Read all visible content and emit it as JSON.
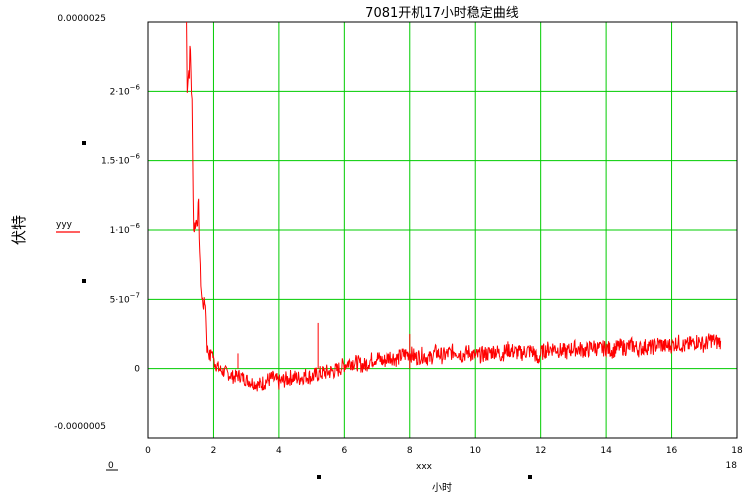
{
  "chart_data": {
    "type": "line",
    "title": "7081开机17小时稳定曲线",
    "xlabel": "小时",
    "ylabel": "伏特",
    "x_var_label": "xxx",
    "x_min_label": "0",
    "x_max_label": "18",
    "y_top_label": "0.0000025",
    "y_bottom_label": "-0.0000005",
    "xlim": [
      0,
      18
    ],
    "ylim": [
      -5e-07,
      2.5e-06
    ],
    "x_ticks": [
      "0",
      "2",
      "4",
      "6",
      "8",
      "10",
      "12",
      "14",
      "16",
      "18"
    ],
    "x_tick_values": [
      0,
      2,
      4,
      6,
      8,
      10,
      12,
      14,
      16,
      18
    ],
    "y_ticks": [
      {
        "value": 2e-06,
        "mantissa": "2",
        "exp": "−6"
      },
      {
        "value": 1.5e-06,
        "mantissa": "1.5",
        "exp": "−6"
      },
      {
        "value": 1e-06,
        "mantissa": "1",
        "exp": "−6"
      },
      {
        "value": 5e-07,
        "mantissa": "5",
        "exp": "−7"
      },
      {
        "value": 0,
        "mantissa": "0",
        "exp": ""
      }
    ],
    "grid": true,
    "grid_color": "#00cc00",
    "legend": {
      "name": "yyy",
      "placement": "left"
    },
    "series": [
      {
        "name": "yyy",
        "color": "#ff0000",
        "x": [
          1.18,
          1.2,
          1.25,
          1.3,
          1.35,
          1.4,
          1.45,
          1.5,
          1.55,
          1.6,
          1.65,
          1.7,
          1.75,
          1.8,
          1.85,
          1.9,
          1.95,
          2.0,
          2.1,
          2.2,
          2.4,
          2.6,
          2.8,
          3.0,
          3.2,
          3.4,
          3.6,
          3.8,
          4.0,
          4.2,
          4.4,
          4.6,
          4.8,
          5.0,
          5.2,
          5.4,
          5.6,
          5.8,
          6.0,
          6.2,
          6.4,
          6.6,
          6.8,
          7.0,
          7.2,
          7.4,
          7.6,
          7.8,
          8.0,
          8.2,
          8.4,
          8.6,
          8.8,
          9.0,
          9.2,
          9.4,
          9.6,
          9.8,
          10.0,
          10.2,
          10.4,
          10.6,
          10.8,
          11.0,
          11.2,
          11.4,
          11.6,
          11.8,
          11.9,
          12.0,
          12.2,
          12.4,
          12.6,
          12.8,
          13.0,
          13.2,
          13.4,
          13.6,
          13.8,
          14.0,
          14.2,
          14.4,
          14.6,
          14.8,
          15.0,
          15.2,
          15.4,
          15.6,
          15.8,
          16.0,
          16.2,
          16.4,
          16.6,
          16.8,
          17.0,
          17.2,
          17.4,
          17.5
        ],
        "values": [
          2.5e-06,
          2.05e-06,
          2.15e-06,
          2.28e-06,
          1.9e-06,
          1e-06,
          1.05e-06,
          1.08e-06,
          1.15e-06,
          7e-07,
          5e-07,
          4.6e-07,
          4.8e-07,
          1.5e-07,
          1.2e-07,
          8e-08,
          1.4e-07,
          6e-08,
          2e-08,
          -1e-08,
          -3e-08,
          -6e-08,
          -5e-08,
          -8e-08,
          -1e-07,
          -1.2e-07,
          -9e-08,
          -7e-08,
          -1e-07,
          -8e-08,
          -6e-08,
          -7e-08,
          -5e-08,
          -6e-08,
          -4e-08,
          -3e-08,
          -2e-08,
          -1e-08,
          3e-08,
          5e-08,
          4e-08,
          2e-08,
          6e-08,
          8e-08,
          5e-08,
          9e-08,
          7e-08,
          1e-07,
          1.1e-07,
          8e-08,
          1e-07,
          7e-08,
          1.2e-07,
          9e-08,
          1.1e-07,
          1.3e-07,
          1e-07,
          1.2e-07,
          9e-08,
          1e-07,
          1.1e-07,
          1.3e-07,
          1e-07,
          1.4e-07,
          1.2e-07,
          1.1e-07,
          1.3e-07,
          1.2e-07,
          5e-08,
          1.1e-07,
          1.4e-07,
          1.5e-07,
          1.3e-07,
          1.2e-07,
          1.5e-07,
          1.4e-07,
          1.3e-07,
          1.6e-07,
          1.4e-07,
          1.5e-07,
          1.3e-07,
          1.6e-07,
          1.5e-07,
          1.7e-07,
          1.4e-07,
          1.6e-07,
          1.5e-07,
          1.8e-07,
          1.6e-07,
          1.7e-07,
          1.9e-07,
          1.6e-07,
          1.8e-07,
          2e-07,
          1.7e-07,
          2.1e-07,
          1.9e-07,
          2e-07
        ],
        "noise": [
          0,
          8e-08,
          1.2e-07,
          1e-07,
          8e-08,
          6e-08,
          6e-08,
          8e-08,
          8e-08,
          6e-08,
          6e-08,
          5e-08,
          5e-08,
          5e-08,
          5e-08,
          5e-08,
          5e-08,
          5e-08,
          5e-08,
          5e-08,
          5e-08,
          5e-08,
          5e-08,
          5e-08,
          5e-08,
          6e-08,
          6e-08,
          6e-08,
          6e-08,
          6e-08,
          6e-08,
          6e-08,
          6e-08,
          6e-08,
          6e-08,
          6e-08,
          6e-08,
          6e-08,
          6e-08,
          6e-08,
          6e-08,
          6e-08,
          6e-08,
          6e-08,
          6e-08,
          6e-08,
          6e-08,
          6e-08,
          6e-08,
          6e-08,
          6e-08,
          6e-08,
          6e-08,
          6e-08,
          6e-08,
          6e-08,
          6e-08,
          6e-08,
          6e-08,
          6e-08,
          6e-08,
          6e-08,
          6e-08,
          6e-08,
          6e-08,
          6e-08,
          6e-08,
          6e-08,
          6e-08,
          6e-08,
          6e-08,
          6e-08,
          6e-08,
          6e-08,
          6e-08,
          6e-08,
          6e-08,
          6e-08,
          6e-08,
          6e-08,
          6e-08,
          6e-08,
          6e-08,
          6e-08,
          6e-08,
          6e-08,
          6e-08,
          6e-08,
          6e-08,
          6e-08,
          6e-08,
          6e-08,
          6e-08,
          6e-08,
          6e-08,
          6e-08,
          6e-08,
          6e-08
        ],
        "spikes": [
          {
            "x": 2.75,
            "value": 1.1e-07
          },
          {
            "x": 5.2,
            "value": 3.3e-07
          },
          {
            "x": 8.0,
            "value": 2.5e-07
          }
        ]
      }
    ]
  }
}
